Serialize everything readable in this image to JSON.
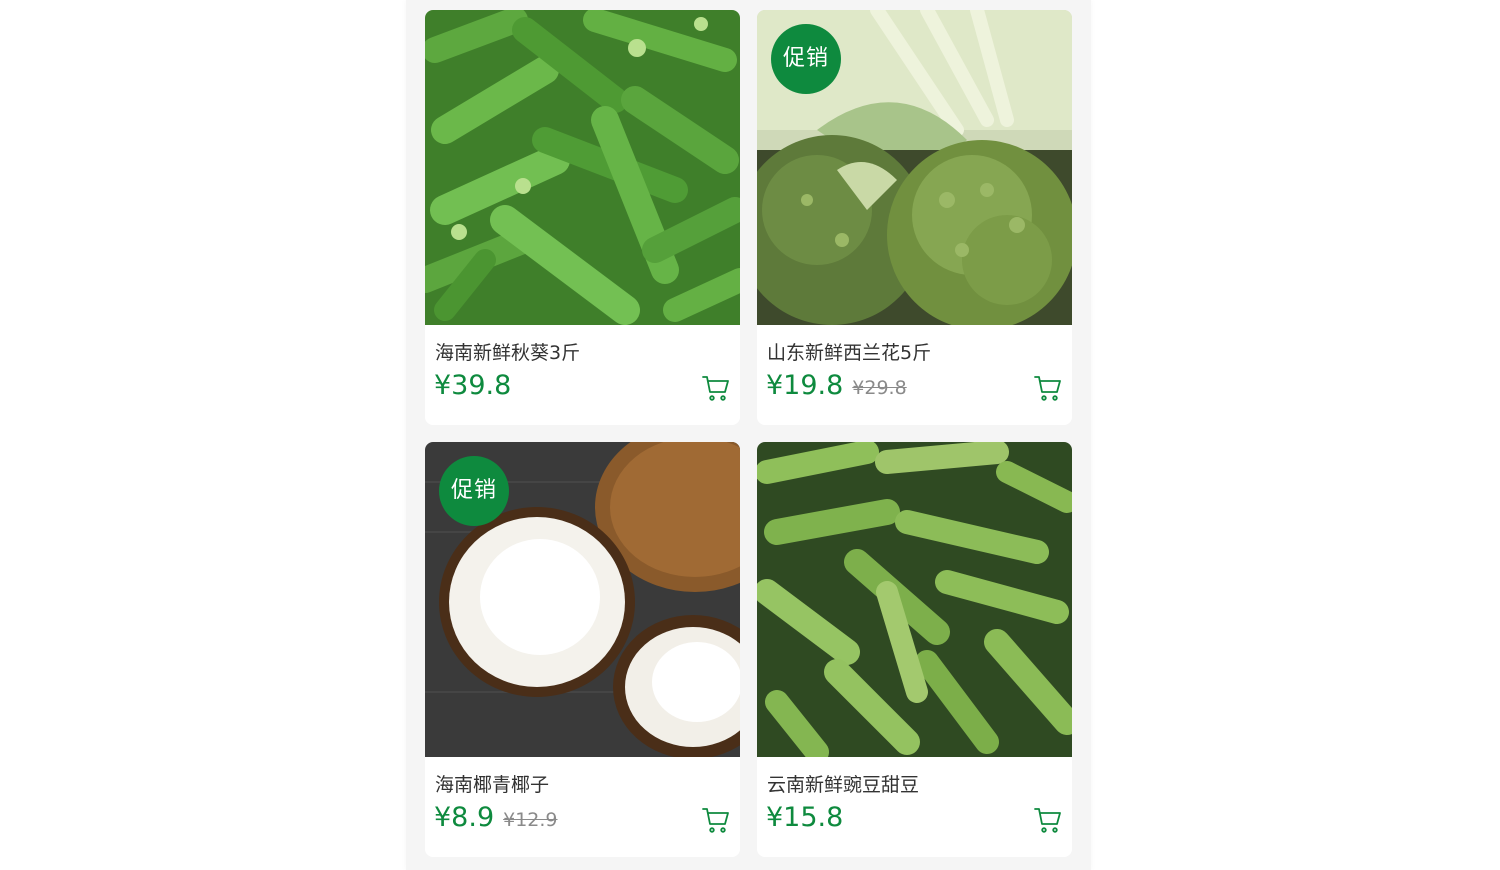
{
  "colors": {
    "accent": "#0e8a3e",
    "old_price": "#8a8a8a",
    "page_bg": "#f5f5f5"
  },
  "products": [
    {
      "name": "海南新鲜秋葵3斤",
      "price": "¥39.8",
      "old_price": "",
      "badge": "",
      "image": "okra-photo"
    },
    {
      "name": "山东新鲜西兰花5斤",
      "price": "¥19.8",
      "old_price": "¥29.8",
      "badge": "促销",
      "image": "broccoli-photo"
    },
    {
      "name": "海南椰青椰子",
      "price": "¥8.9",
      "old_price": "¥12.9",
      "badge": "促销",
      "image": "coconut-photo"
    },
    {
      "name": "云南新鲜豌豆甜豆",
      "price": "¥15.8",
      "old_price": "",
      "badge": "",
      "image": "peas-photo"
    }
  ],
  "icons": {
    "cart": "shopping-cart-icon"
  }
}
